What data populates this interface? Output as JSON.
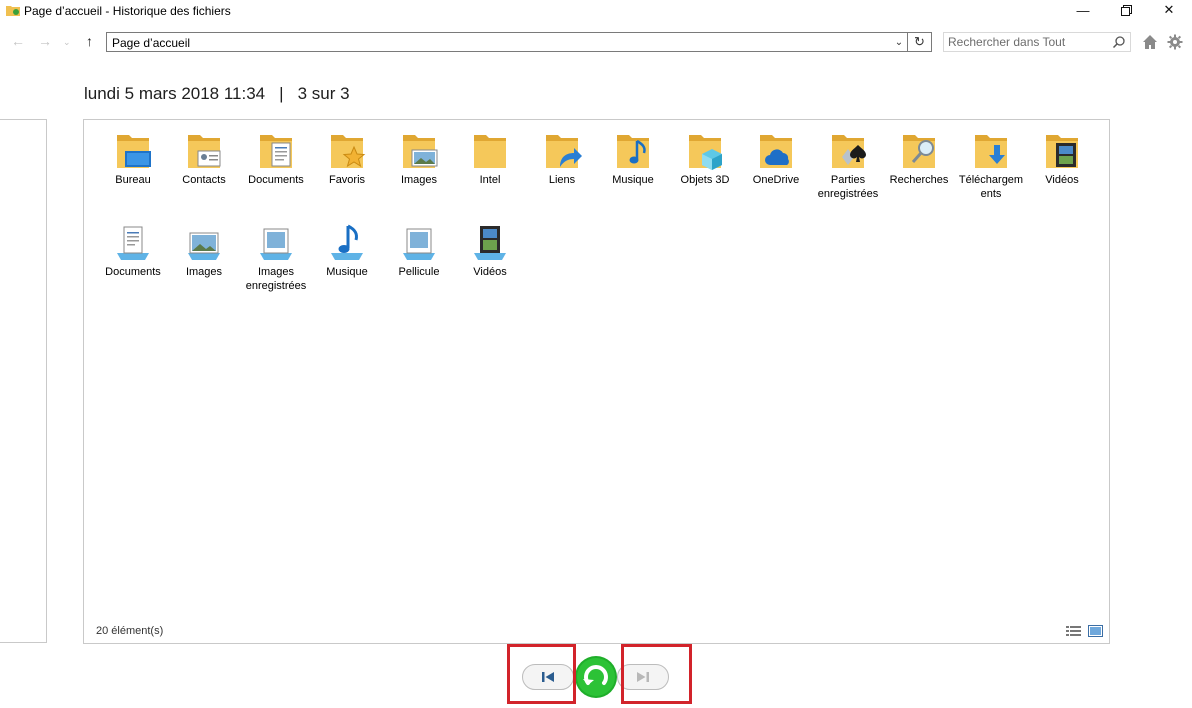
{
  "window": {
    "title": "Page d’accueil - Historique des fichiers",
    "icons": [
      "app-icon",
      "minimize-icon",
      "maximize-icon",
      "close-icon"
    ]
  },
  "address_bar": {
    "path": "Page d’accueil",
    "search_placeholder": "Rechercher dans Tout"
  },
  "snapshot": {
    "date": "lundi 5 mars 2018 11:34",
    "separator": "|",
    "position": "3 sur 3"
  },
  "folders": [
    {
      "label": "Bureau",
      "icon": "folder-desktop-icon"
    },
    {
      "label": "Contacts",
      "icon": "folder-contacts-icon"
    },
    {
      "label": "Documents",
      "icon": "folder-documents-icon"
    },
    {
      "label": "Favoris",
      "icon": "folder-favorites-icon"
    },
    {
      "label": "Images",
      "icon": "folder-images-icon"
    },
    {
      "label": "Intel",
      "icon": "folder-icon"
    },
    {
      "label": "Liens",
      "icon": "folder-links-icon"
    },
    {
      "label": "Musique",
      "icon": "folder-music-icon"
    },
    {
      "label": "Objets 3D",
      "icon": "folder-3d-objects-icon"
    },
    {
      "label": "OneDrive",
      "icon": "folder-onedrive-icon"
    },
    {
      "label": "Parties enregistrées",
      "icon": "folder-saved-games-icon"
    },
    {
      "label": "Recherches",
      "icon": "folder-searches-icon"
    },
    {
      "label": "Téléchargements",
      "icon": "folder-downloads-icon"
    },
    {
      "label": "Vidéos",
      "icon": "folder-videos-icon"
    }
  ],
  "libraries": [
    {
      "label": "Documents",
      "icon": "library-documents-icon"
    },
    {
      "label": "Images",
      "icon": "library-images-icon"
    },
    {
      "label": "Images enregistrées",
      "icon": "library-saved-pictures-icon"
    },
    {
      "label": "Musique",
      "icon": "library-music-icon"
    },
    {
      "label": "Pellicule",
      "icon": "library-camera-roll-icon"
    },
    {
      "label": "Vidéos",
      "icon": "library-videos-icon"
    }
  ],
  "status": {
    "count": "20 élément(s)"
  },
  "colors": {
    "folder": "#f5c85a",
    "folder_dark": "#e0a732",
    "restore_green": "#1fae2a",
    "highlight_red": "#d2232a",
    "nav_blue": "#2a5c8f"
  }
}
